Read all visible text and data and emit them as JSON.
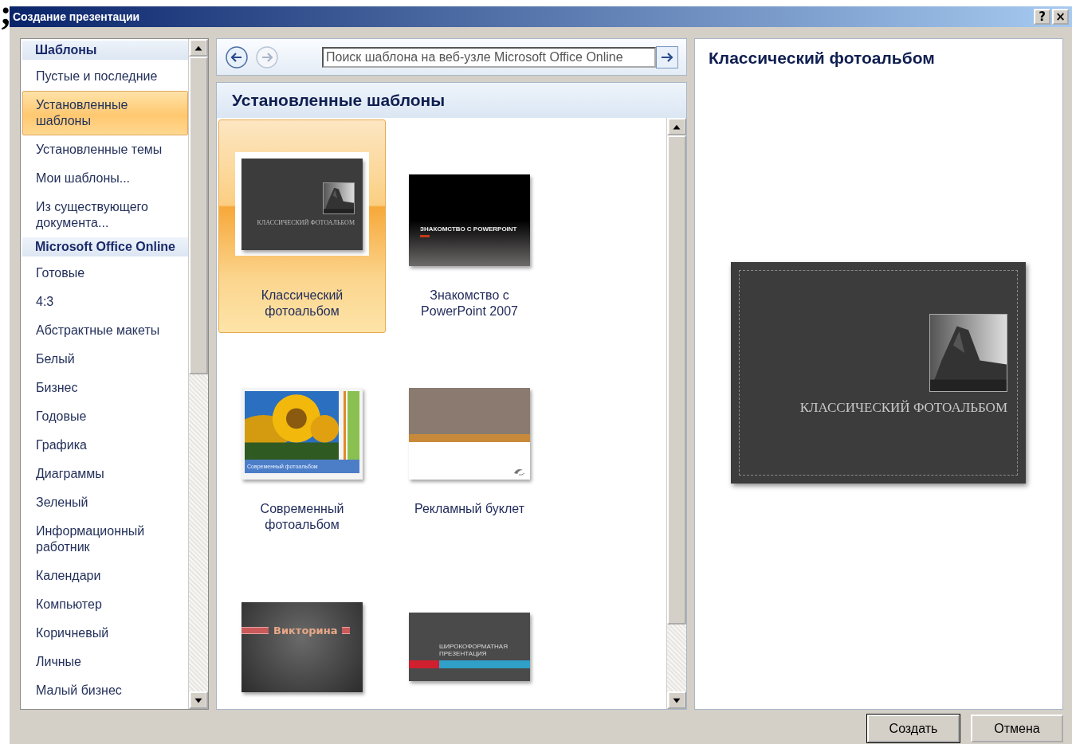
{
  "corner_mark": ";",
  "window": {
    "title": "Создание презентации",
    "help": "?",
    "close": "×"
  },
  "sidebar": {
    "items": [
      {
        "kind": "header",
        "label": "Шаблоны"
      },
      {
        "kind": "item",
        "label": "Пустые и последние",
        "selected": false
      },
      {
        "kind": "item",
        "label": "Установленные шаблоны",
        "selected": true
      },
      {
        "kind": "item",
        "label": "Установленные темы",
        "selected": false
      },
      {
        "kind": "item",
        "label": "Мои шаблоны...",
        "selected": false
      },
      {
        "kind": "item",
        "label": "Из существующего документа...",
        "selected": false
      },
      {
        "kind": "header",
        "label": "Microsoft Office Online"
      },
      {
        "kind": "item",
        "label": "Готовые",
        "selected": false
      },
      {
        "kind": "item",
        "label": "4:3",
        "selected": false
      },
      {
        "kind": "item",
        "label": "Абстрактные макеты",
        "selected": false
      },
      {
        "kind": "item",
        "label": "Белый",
        "selected": false
      },
      {
        "kind": "item",
        "label": "Бизнес",
        "selected": false
      },
      {
        "kind": "item",
        "label": "Годовые",
        "selected": false
      },
      {
        "kind": "item",
        "label": "Графика",
        "selected": false
      },
      {
        "kind": "item",
        "label": "Диаграммы",
        "selected": false
      },
      {
        "kind": "item",
        "label": "Зеленый",
        "selected": false
      },
      {
        "kind": "item",
        "label": "Информационный работник",
        "selected": false
      },
      {
        "kind": "item",
        "label": "Календари",
        "selected": false
      },
      {
        "kind": "item",
        "label": "Компьютер",
        "selected": false
      },
      {
        "kind": "item",
        "label": "Коричневый",
        "selected": false
      },
      {
        "kind": "item",
        "label": "Личные",
        "selected": false
      },
      {
        "kind": "item",
        "label": "Малый бизнес",
        "selected": false
      }
    ]
  },
  "search": {
    "placeholder": "Поиск шаблона на веб-узле Microsoft Office Online"
  },
  "gallery": {
    "title": "Установленные шаблоны",
    "templates": [
      {
        "name": "Классический фотоальбом",
        "selected": true,
        "thumb": {
          "kind": "classic",
          "text": "КЛАССИЧЕСКИЙ ФОТОАЛЬБОМ"
        }
      },
      {
        "name": "Знакомство с PowerPoint 2007",
        "selected": false,
        "thumb": {
          "kind": "intro",
          "text": "ЗНАКОМСТВО С POWERPOINT"
        }
      },
      {
        "name": "Современный фотоальбом",
        "selected": false,
        "thumb": {
          "kind": "modern",
          "text": "Современный фотоальбом"
        }
      },
      {
        "name": "Рекламный буклет",
        "selected": false,
        "thumb": {
          "kind": "booklet"
        }
      },
      {
        "selected": false,
        "thumb": {
          "kind": "quiz",
          "text": "Викторина"
        }
      },
      {
        "selected": false,
        "thumb": {
          "kind": "wide",
          "text": "ШИРОКОФОРМАТНАЯ ПРЕЗЕНТАЦИЯ"
        }
      }
    ]
  },
  "preview": {
    "title": "Классический фотоальбом",
    "slide_text": "КЛАССИЧЕСКИЙ ФОТОАЛЬБОМ"
  },
  "buttons": [
    "Создать",
    "Отмена"
  ]
}
